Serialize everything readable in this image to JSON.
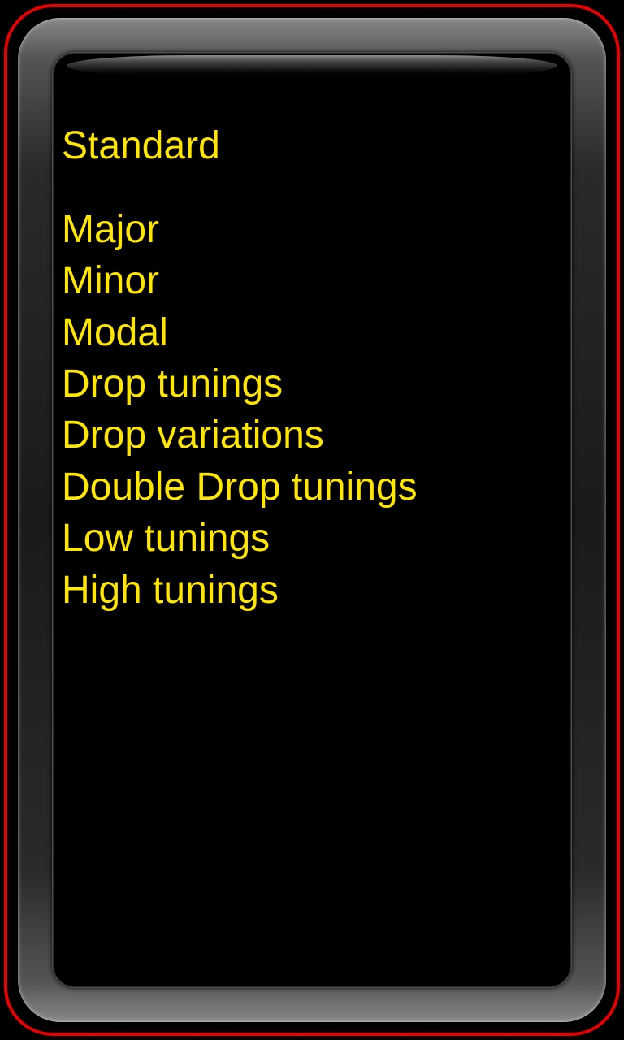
{
  "heading": "Standard",
  "menu": {
    "items": [
      "Major",
      "Minor",
      "Modal",
      "Drop tunings",
      "Drop variations",
      "Double Drop tunings",
      "Low tunings",
      "High tunings"
    ]
  },
  "colors": {
    "text": "#ffe600",
    "accent": "#e60000",
    "background": "#000000"
  }
}
